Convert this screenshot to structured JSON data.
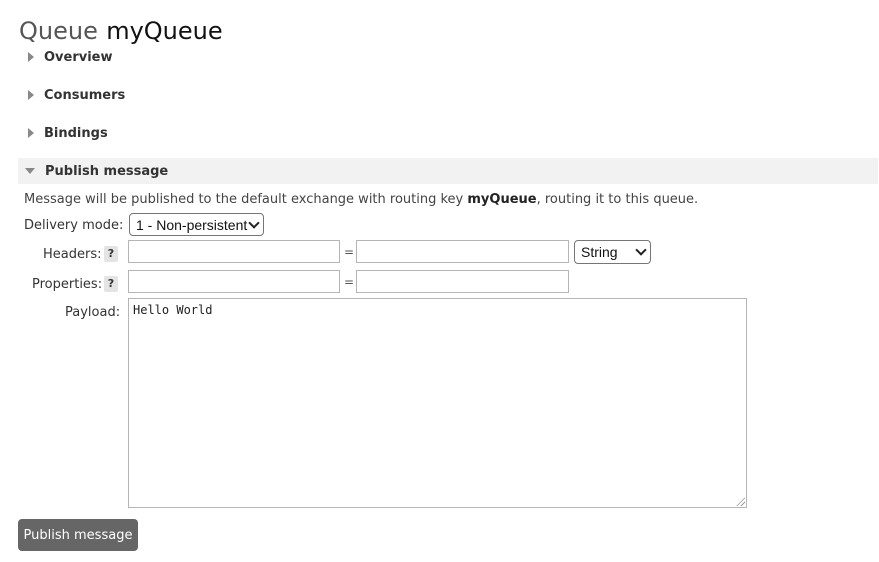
{
  "page": {
    "title_prefix": "Queue",
    "queue_name": "myQueue"
  },
  "sections": {
    "overview": "Overview",
    "consumers": "Consumers",
    "bindings": "Bindings",
    "publish": "Publish message"
  },
  "publish_form": {
    "note_prefix": "Message will be published to the default exchange with routing key ",
    "note_key": "myQueue",
    "note_suffix": ", routing it to this queue.",
    "delivery_mode_label": "Delivery mode:",
    "delivery_mode_value": "1 - Non-persistent",
    "headers_label": "Headers:",
    "properties_label": "Properties:",
    "help_symbol": "?",
    "equals_symbol": "=",
    "header_type_value": "String",
    "header_key": "",
    "header_value": "",
    "property_key": "",
    "property_value": "",
    "payload_label": "Payload:",
    "payload_value": "Hello World",
    "submit_label": "Publish message"
  },
  "icons": {
    "collapsed": "triangle-right-icon",
    "expanded": "triangle-down-icon",
    "dropdown": "chevron-down-icon",
    "resize": "resize-grip-icon"
  },
  "colors": {
    "button_bg": "#666666",
    "expanded_header_bg": "#f2f2f2",
    "help_bg": "#e4e4e4"
  }
}
